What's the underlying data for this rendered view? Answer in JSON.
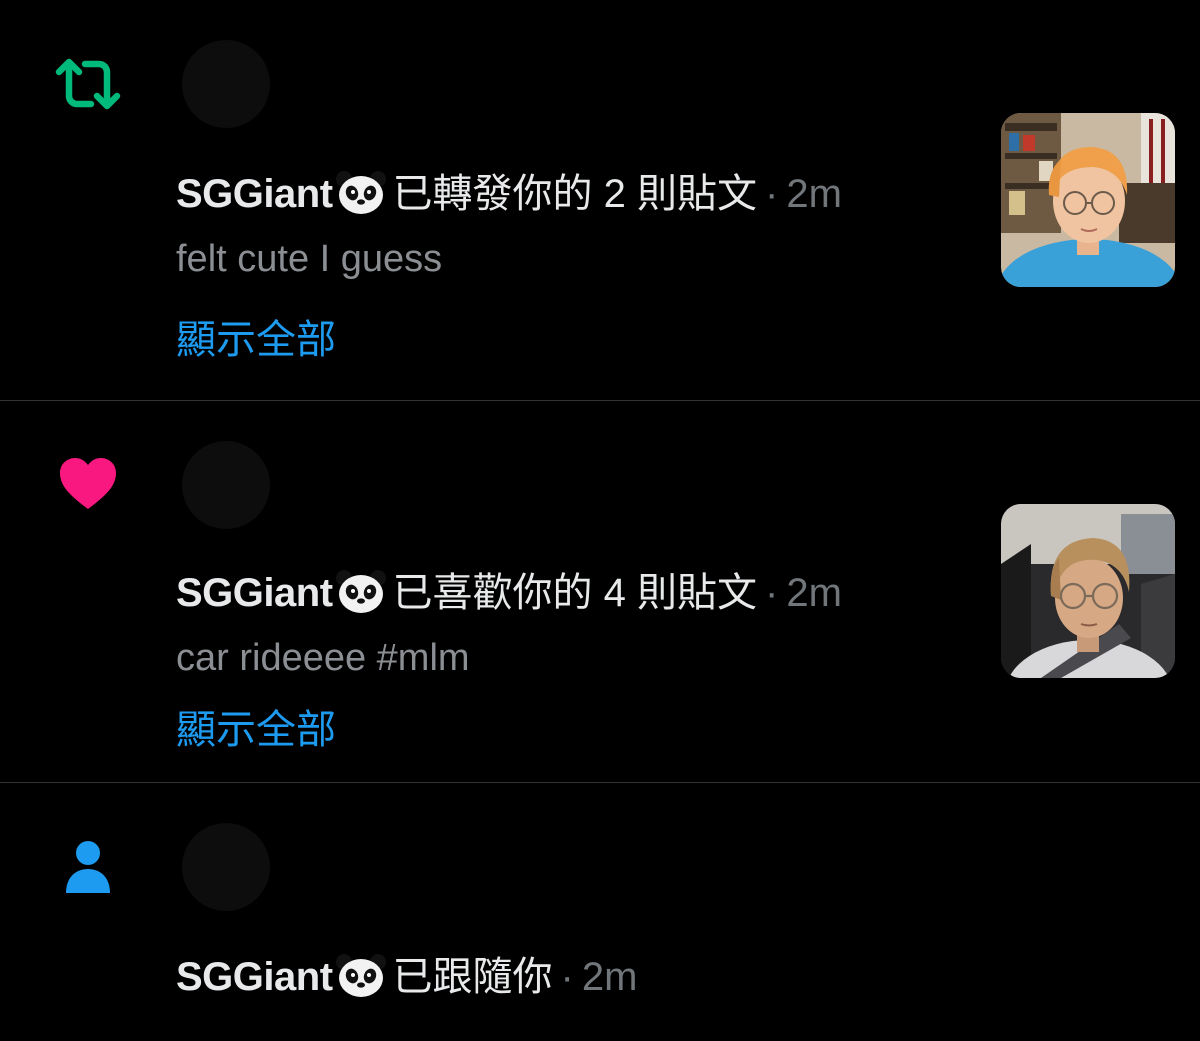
{
  "colors": {
    "background": "#000000",
    "retweet_green": "#00ba7c",
    "like_pink": "#f91880",
    "follow_blue": "#1d9bf0",
    "secondary_text": "#71767b",
    "link_blue": "#1d9bf0"
  },
  "notifications": [
    {
      "type_icon": "retweet-icon",
      "user_name": "SGGiant",
      "action": "已轉發你的 2 則貼文",
      "separator": "·",
      "time": "2m",
      "snippet": "felt cute I guess",
      "show_all": "顯示全部",
      "has_thumbnail": true
    },
    {
      "type_icon": "heart-icon",
      "user_name": "SGGiant",
      "action": "已喜歡你的 4 則貼文",
      "separator": "·",
      "time": "2m",
      "snippet": "car rideeee #mlm",
      "show_all": "顯示全部",
      "has_thumbnail": true
    },
    {
      "type_icon": "person-icon",
      "user_name": "SGGiant",
      "action": "已跟隨你",
      "separator": "·",
      "time": "2m"
    }
  ]
}
